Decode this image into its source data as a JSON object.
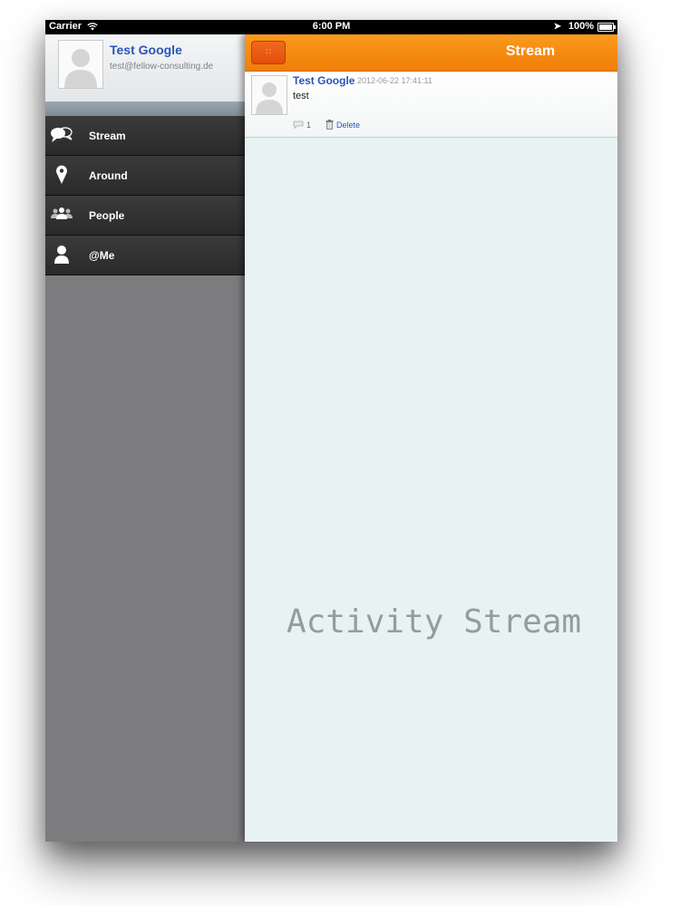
{
  "status_bar": {
    "carrier": "Carrier",
    "wifi_icon": "wifi-icon",
    "time": "6:00 PM",
    "location_icon": "location-arrow-icon",
    "battery": "100%",
    "battery_level": 1.0
  },
  "sidebar": {
    "profile": {
      "name": "Test Google",
      "email": "test@fellow-consulting.de",
      "avatar_icon": "default-avatar-icon"
    },
    "items": [
      {
        "label": "Stream",
        "icon": "speech-bubbles-icon"
      },
      {
        "label": "Around",
        "icon": "map-pin-icon"
      },
      {
        "label": "People",
        "icon": "people-icon"
      },
      {
        "label": "@Me",
        "icon": "person-icon"
      }
    ]
  },
  "header": {
    "title": "Stream",
    "menu_icon": "grid-icon",
    "accent_color": "#f58a10"
  },
  "feed": {
    "posts": [
      {
        "author": "Test Google",
        "timestamp": "2012-06-22 17:41:11",
        "text": "test",
        "comment_count": "1",
        "delete_label": "Delete"
      }
    ]
  },
  "watermark": "Activity Stream"
}
